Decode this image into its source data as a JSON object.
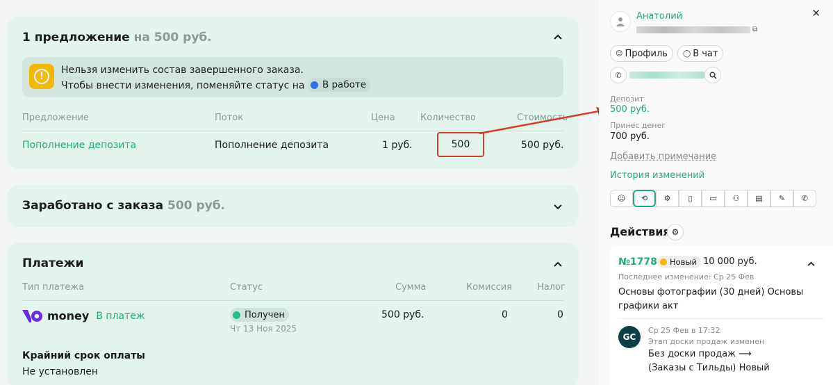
{
  "offer_card": {
    "title": "1 предложение",
    "title_amount": "на 500 руб.",
    "notice_line1": "Нельзя изменить состав завершенного заказа.",
    "notice_line2": "Чтобы внести изменения, поменяйте статус на",
    "notice_status": "В работе",
    "notice_status_color": "#2b6ff3",
    "columns": [
      "Предложение",
      "Поток",
      "Цена",
      "Количество",
      "Стоимость"
    ],
    "row": {
      "offer": "Пополнение депозита",
      "stream": "Пополнение депозита",
      "price": "1 руб.",
      "quantity": "500",
      "cost": "500 руб."
    }
  },
  "earned_card": {
    "title": "Заработано с заказа",
    "amount": "500 руб."
  },
  "payments_card": {
    "title": "Платежи",
    "columns": [
      "Тип платежа",
      "Статус",
      "Сумма",
      "Комиссия",
      "Налог"
    ],
    "row": {
      "provider": "money",
      "provider_link": "В платеж",
      "status": "Получен",
      "status_color": "#22c08a",
      "date": "Чт 13 Ноя 2025",
      "sum": "500 руб.",
      "commission": "0",
      "tax": "0"
    },
    "deadline_label": "Крайний срок оплаты",
    "deadline_value": "Не установлен"
  },
  "sidebar": {
    "user_name": "Анатолий",
    "profile_button": "Профиль",
    "chat_button": "В чат",
    "deposit_label": "Депозит",
    "deposit_value": "500 руб.",
    "brought_label": "Принес денег",
    "brought_value": "700 руб.",
    "add_note": "Добавить примечание",
    "history_link": "История изменений",
    "tabs": [
      "user-icon",
      "history-icon",
      "settings-icon",
      "phone-device-icon",
      "video-icon",
      "users-icon",
      "clipboard-icon",
      "pen-icon",
      "phone-icon"
    ],
    "actions_title": "Действия",
    "order": {
      "number": "№1778",
      "badge": "Новый",
      "badge_color": "#f5b800",
      "sum": "10 000 руб.",
      "last_change": "Последнее изменение: Ср 25 Фев",
      "title": "Основы фотографии (30 дней) Основы графики акт",
      "event_logo": "GC",
      "event_time": "Ср 25 Фев в 17:32",
      "event_type": "Этап доски продаж изменен",
      "event_line1": "Без доски продаж ⟶",
      "event_line2": "(Заказы с Тильды) Новый"
    }
  },
  "colors": {
    "accent": "#1fad74",
    "card_bg": "#e2f4ec",
    "highlight": "#d63c2f"
  }
}
